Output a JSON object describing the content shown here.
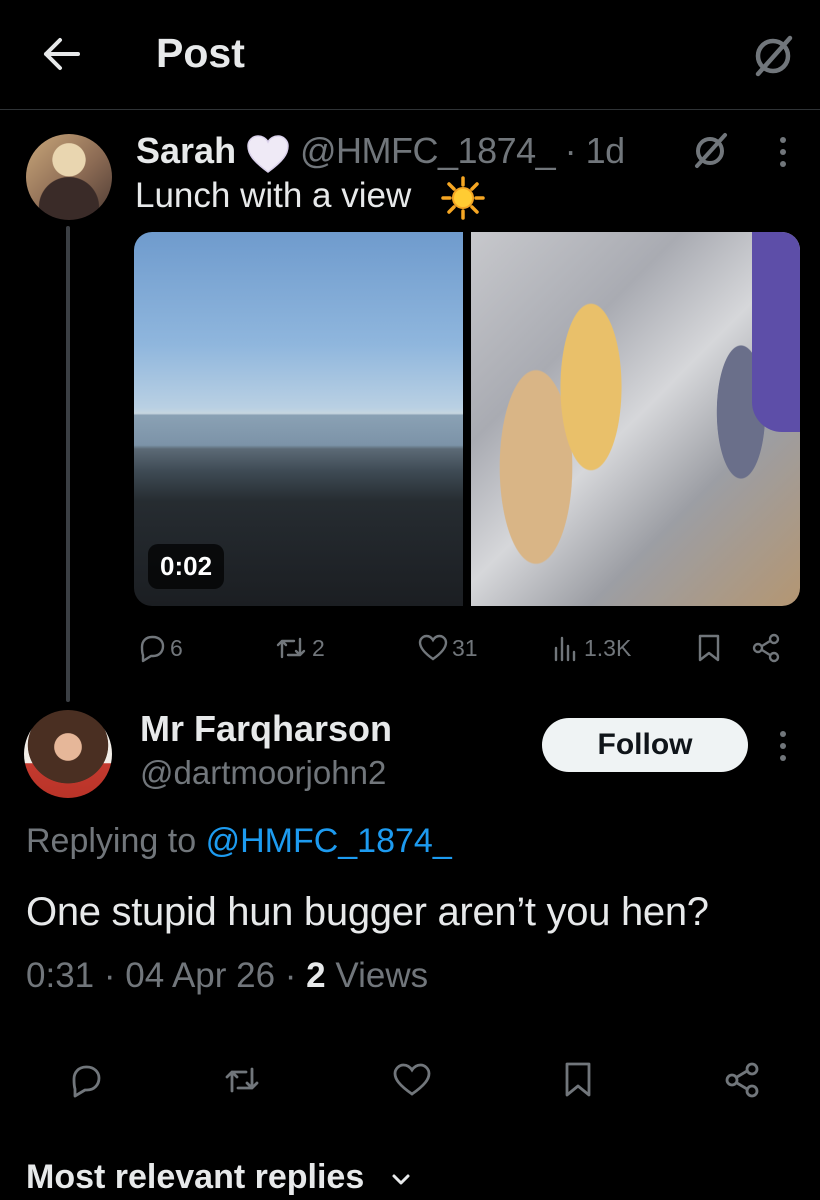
{
  "header": {
    "title": "Post"
  },
  "parent_post": {
    "display_name": "Sarah",
    "handle_time": "@HMFC_1874_ · 1d",
    "text": "Lunch with a view",
    "video_duration": "0:02",
    "stats": {
      "replies": "6",
      "reposts": "2",
      "likes": "31",
      "views": "1.3K"
    }
  },
  "reply": {
    "display_name": "Mr Farqharson",
    "handle": "@dartmoorjohn2",
    "follow_label": "Follow",
    "replying_prefix": "Replying to",
    "replying_handle": "@HMFC_1874_",
    "text": "One stupid hun bugger aren’t you hen?",
    "timestamp": "0:31 · 04 Apr 26 · ",
    "views_count": "2",
    "views_label": " Views"
  },
  "replies_sort": {
    "label": "Most relevant replies"
  },
  "colors": {
    "background": "#000000",
    "link": "#1d9bf0",
    "muted": "#71767b",
    "text": "#e7e9ea"
  },
  "icons": [
    "back-arrow-icon",
    "grok-icon",
    "white-heart-emoji",
    "sun-emoji",
    "more-icon",
    "reply-icon",
    "repost-icon",
    "like-icon",
    "views-icon",
    "bookmark-icon",
    "share-icon",
    "chevron-down-icon"
  ]
}
